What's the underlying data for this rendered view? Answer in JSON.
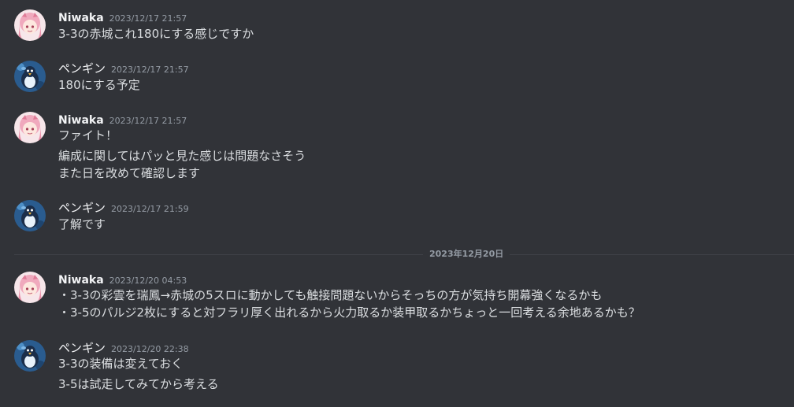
{
  "messages": [
    {
      "author": "Niwaka",
      "timestamp": "2023/12/17 21:57",
      "avatar": "niwaka-avatar",
      "lines": [
        "3-3の赤城これ180にする感じですか"
      ]
    },
    {
      "author": "ペンギン",
      "timestamp": "2023/12/17 21:57",
      "avatar": "penguin-avatar",
      "lines": [
        "180にする予定"
      ]
    },
    {
      "author": "Niwaka",
      "timestamp": "2023/12/17 21:57",
      "avatar": "niwaka-avatar",
      "lines": [
        "ファイト！",
        "編成に関してはパッと見た感じは問題なさそう",
        "また日を改めて確認します"
      ]
    },
    {
      "author": "ペンギン",
      "timestamp": "2023/12/17 21:59",
      "avatar": "penguin-avatar",
      "lines": [
        "了解です"
      ]
    },
    {
      "author": "Niwaka",
      "timestamp": "2023/12/20 04:53",
      "avatar": "niwaka-avatar",
      "lines": [
        "・3-3の彩雲を瑞鳳→赤城の5スロに動かしても触接問題ないからそっちの方が気持ち開幕強くなるかも",
        "・3-5のパルジ2枚にすると対フラリ厚く出れるから火力取るか装甲取るかちょっと一回考える余地あるかも？"
      ]
    },
    {
      "author": "ペンギン",
      "timestamp": "2023/12/20 22:38",
      "avatar": "penguin-avatar",
      "lines": [
        "3-3の装備は変えておく",
        "3-5は試走してみてから考える"
      ]
    }
  ],
  "date_divider": "2023年12月20日",
  "colors": {
    "background": "#313338",
    "username": "#f2f3f5",
    "text": "#dbdee1",
    "timestamp": "#949ba4",
    "divider": "#3f4147"
  }
}
